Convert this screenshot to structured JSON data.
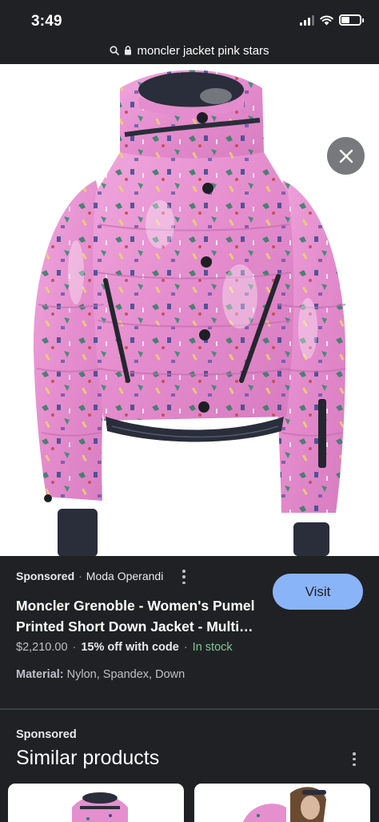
{
  "status_bar": {
    "time": "3:49",
    "signal_icon": "cellular-signal-icon",
    "wifi_icon": "wifi-icon",
    "battery_icon": "battery-icon",
    "battery_level": 0.45
  },
  "url_bar": {
    "search_icon": "search-icon",
    "lock_icon": "lock-icon",
    "url_text": "moncler jacket pink stars"
  },
  "image_viewer": {
    "close_icon": "close-icon",
    "image_alt": "pink printed puffer jacket"
  },
  "product": {
    "sponsored_label": "Sponsored",
    "separator": "·",
    "merchant": "Moda Operandi",
    "more_icon": "more-vert-icon",
    "visit_label": "Visit",
    "title": "Moncler Grenoble - Women's Pumel Printed Short Down Jacket - Multi…",
    "price": "$2,210.00",
    "dot": "·",
    "offer": "15% off with code",
    "stock": "In stock",
    "material_label": "Material:",
    "material_value": "Nylon, Spandex, Down"
  },
  "similar": {
    "sponsored_label": "Sponsored",
    "title": "Similar products",
    "more_icon": "more-vert-icon"
  },
  "colors": {
    "background": "#202124",
    "accent": "#8ab4f8",
    "in_stock": "#81c995",
    "jacket_pink": "#e58fcf"
  }
}
